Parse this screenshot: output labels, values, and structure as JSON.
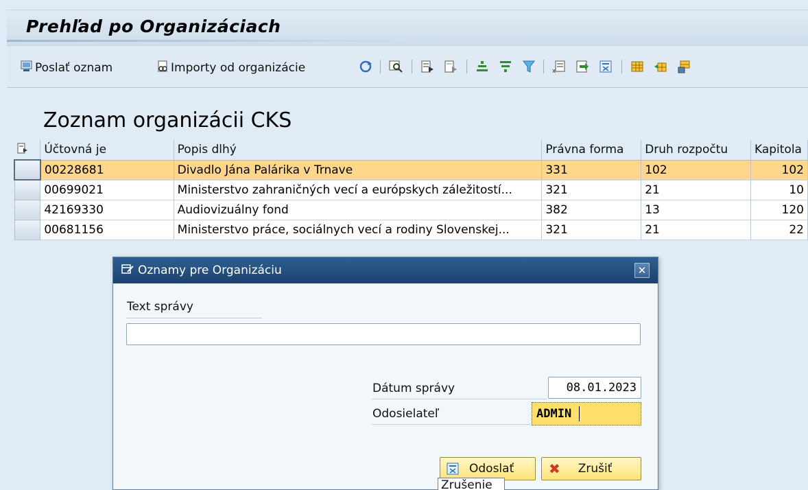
{
  "page": {
    "title": "Prehľad po Organizáciach"
  },
  "toolbar": {
    "send_notice_label": "Poslať oznam",
    "imports_label": "Importy od organizácie"
  },
  "list": {
    "title": "Zoznam organizácii CKS",
    "columns": [
      "Účtovná je",
      "Popis dlhý",
      "Právna forma",
      "Druh rozpočtu",
      "Kapitola"
    ],
    "rows": [
      {
        "ucto": "00228681",
        "popis": "Divadlo Jána Palárika v Trnave",
        "pravna": "331",
        "druh": "102",
        "kapitola": "102"
      },
      {
        "ucto": "00699021",
        "popis": "Ministerstvo zahraničných vecí a európskych záležitostí...",
        "pravna": "321",
        "druh": "21",
        "kapitola": "10"
      },
      {
        "ucto": "42169330",
        "popis": "Audiovizuálny fond",
        "pravna": "382",
        "druh": "13",
        "kapitola": "120"
      },
      {
        "ucto": "00681156",
        "popis": "Ministerstvo práce, sociálnych vecí a rodiny Slovenskej...",
        "pravna": "321",
        "druh": "21",
        "kapitola": "22"
      }
    ],
    "selected_row": 0
  },
  "dialog": {
    "title": "Oznamy pre Organizáciu",
    "message_label": "Text správy",
    "message_value": "",
    "date_label": "Dátum správy",
    "date_value": "08.01.2023",
    "sender_label": "Odosielateľ",
    "sender_value": "ADMIN",
    "send_button": "Odoslať",
    "cancel_button": "Zrušiť",
    "tooltip": "Zrušenie"
  },
  "colors": {
    "selected_row": "#ffd68b",
    "dialog_title": "#2f5e93",
    "button": "#ffe27a",
    "focused_field": "#ffe06b"
  }
}
